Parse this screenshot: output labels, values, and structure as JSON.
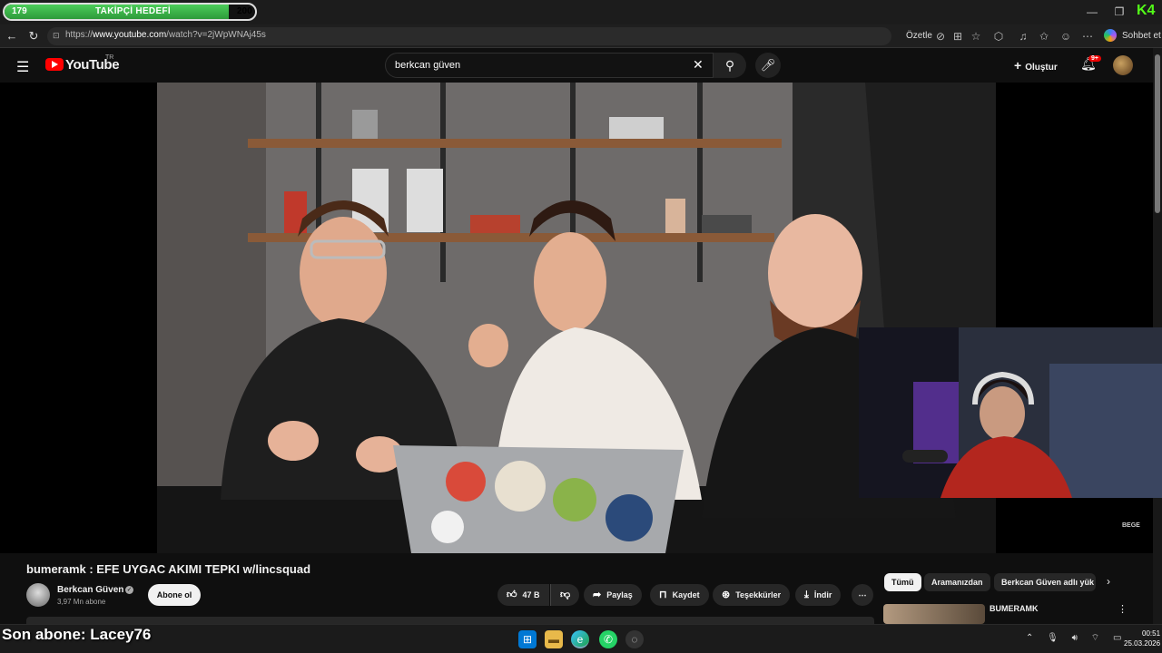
{
  "overlay": {
    "goal_current": "179",
    "goal_label": "TAKİPÇİ HEDEFİ",
    "goal_max": "200",
    "goal_progress": 0.895,
    "last_subscriber": "Son abone: Lacey76",
    "stream_logo": "K4"
  },
  "browser": {
    "url_prefix": "https://",
    "url_host": "www.youtube.com",
    "url_path": "/watch?v=2jWpWNAj45s",
    "summarize_label": "Özetle",
    "chat_label": "Sohbet et"
  },
  "youtube": {
    "logo_text": "YouTube",
    "country": "TR",
    "search_value": "berkcan güven",
    "create_label": "Oluştur",
    "notification_count": "9+"
  },
  "video": {
    "title": "bumeramk : EFE UYGAC AKIMI TEPKI w/lincsquad",
    "watermark": "BEGE",
    "channel_name": "Berkcan Güven",
    "subscribers": "3,97 Mn abone",
    "subscribe_label": "Abone ol",
    "likes": "47 B",
    "share_label": "Paylaş",
    "save_label": "Kaydet",
    "thanks_label": "Teşekkürler",
    "download_label": "İndir"
  },
  "sidebar": {
    "chips": [
      "Tümü",
      "Aramanızdan",
      "Berkcan Güven adlı yük"
    ],
    "rec_title": "BUMERAMK"
  },
  "system": {
    "time": "00:51",
    "date": "25.03.2026",
    "tray_icons": [
      "chevron-up-icon",
      "mic-icon",
      "volume-icon",
      "wifi-icon",
      "battery-icon"
    ]
  },
  "colors": {
    "accent_green": "#53fc18",
    "youtube_red": "#ff0000",
    "bg": "#0f0f0f"
  }
}
